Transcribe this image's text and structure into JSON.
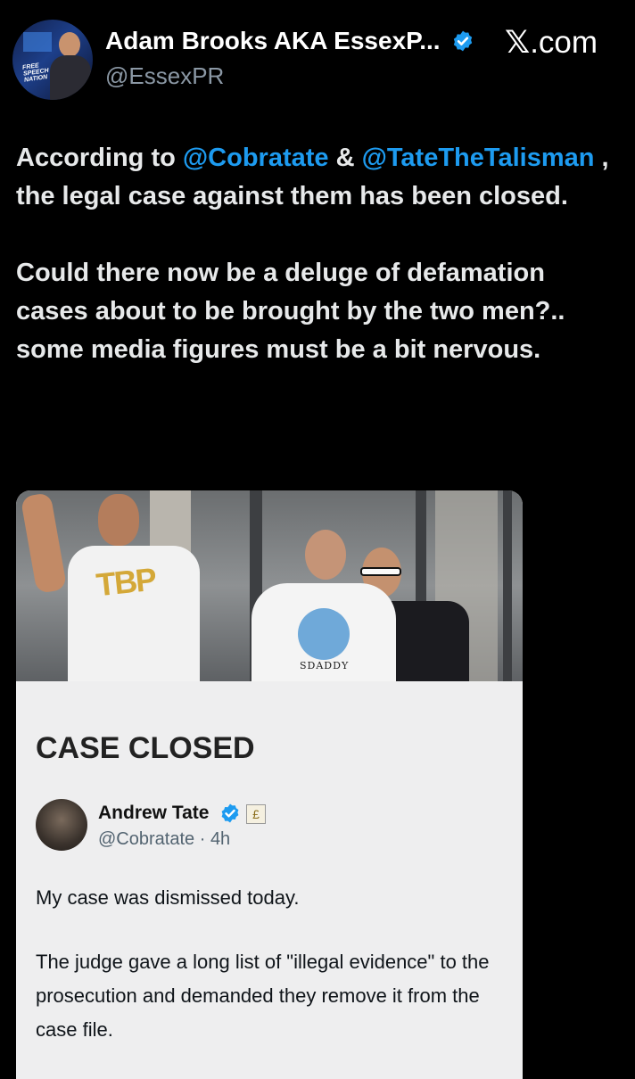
{
  "author": {
    "name": "Adam Brooks AKA EssexP...",
    "handle": "@EssexPR",
    "avatar_text": "FREE SPEECH NATION",
    "verified_icon": "verified-badge-icon"
  },
  "brand": {
    "x_mark": "𝕏",
    "label": ".com"
  },
  "tweet": {
    "paragraph1": {
      "prefix": "According to ",
      "mention1": "@Cobratate",
      "joiner": " & ",
      "mention2": "@TateTheTalisman",
      "suffix": " , the legal case against them has been closed."
    },
    "paragraph2": "Could there now be a deluge of defamation cases about to be brought by the two men?.. some media figures must be a bit nervous."
  },
  "media": {
    "photo_shirt_text": "TBP",
    "photo_shirt_text2": "SDADDY",
    "headline": "CASE CLOSED",
    "embedded_post": {
      "name": "Andrew Tate",
      "handle": "@Cobratate",
      "separator": "·",
      "time": "4h",
      "badge_symbol": "£",
      "line1": "My case was dismissed today.",
      "line2": "The judge gave a long list of \"illegal evidence\" to the prosecution and demanded they remove it from the case file."
    }
  },
  "colors": {
    "background": "#000000",
    "text": "#e7e9ea",
    "muted": "#8b98a5",
    "link": "#1d9bf0",
    "verified": "#1d9bf0"
  }
}
